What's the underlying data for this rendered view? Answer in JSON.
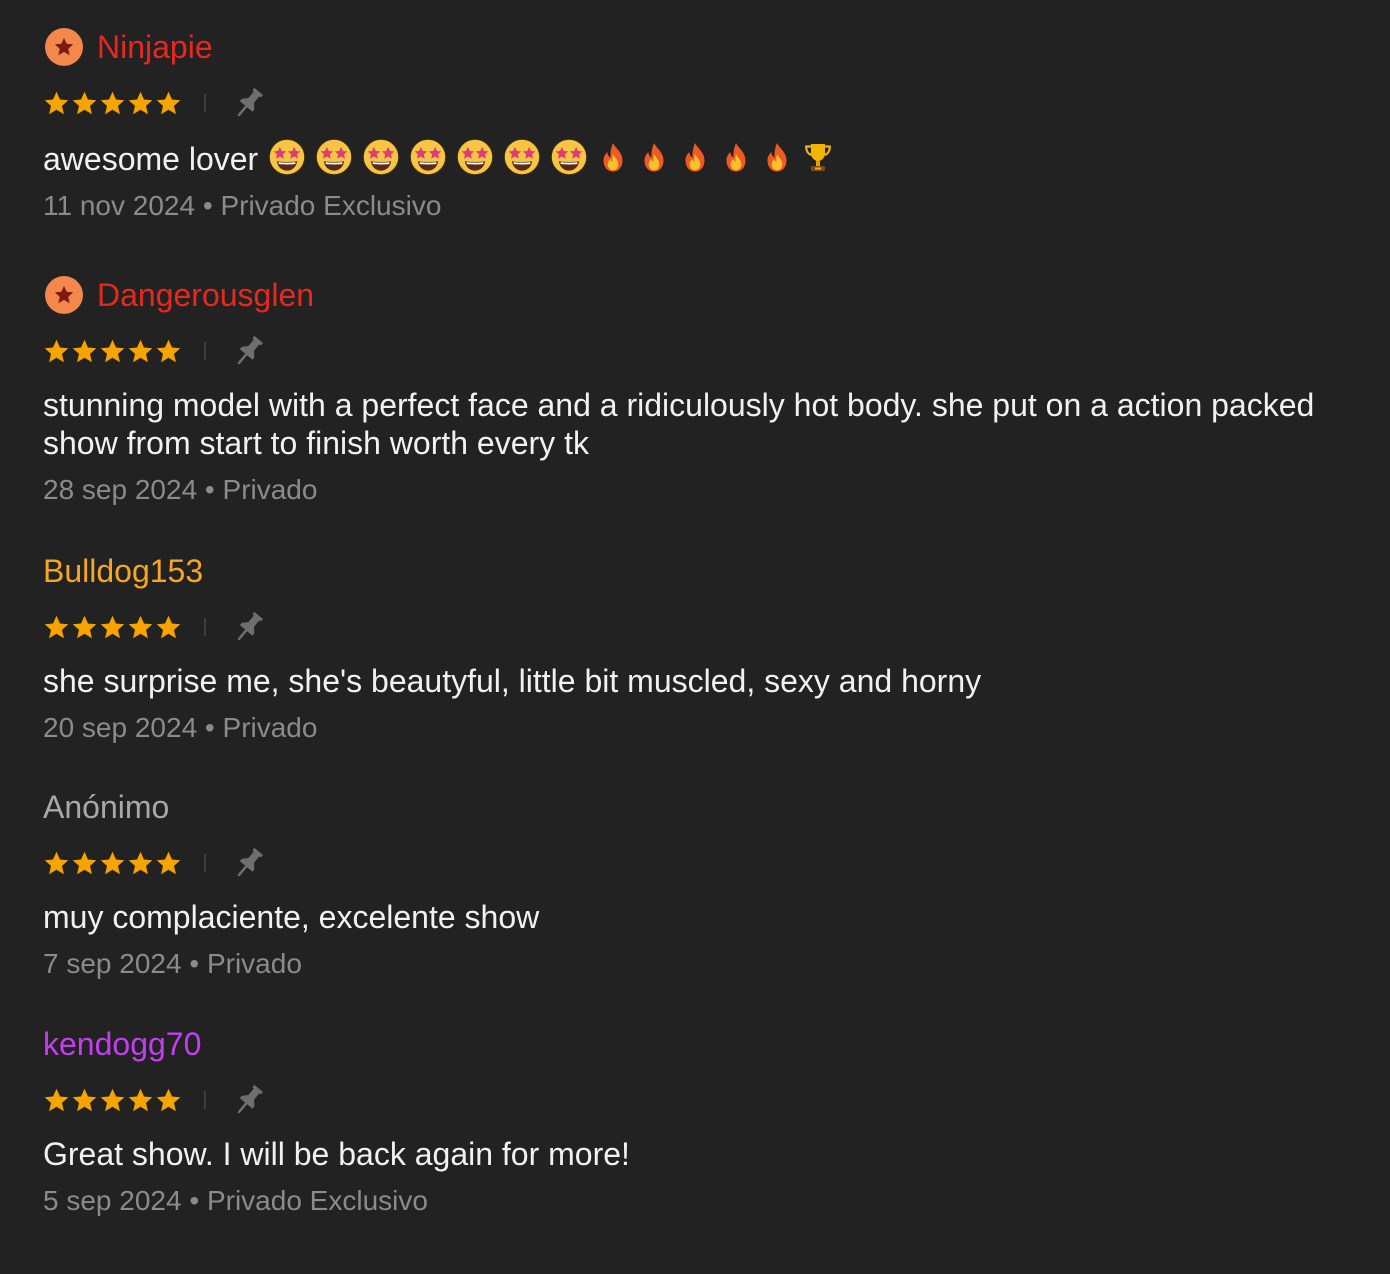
{
  "colors": {
    "background": "#222222",
    "star": "#f7a400",
    "badge": "#f4874b",
    "badge_star": "#7a1a12",
    "pin": "#6e6e6e",
    "meta_text": "#8b8b8b"
  },
  "reviews": [
    {
      "username": "Ninjapie",
      "username_color": "#e8281e",
      "badge": "star-badge-icon",
      "rating": 5,
      "text": "awesome lover",
      "emojis": [
        "star-struck",
        "star-struck",
        "star-struck",
        "star-struck",
        "star-struck",
        "star-struck",
        "star-struck",
        "fire",
        "fire",
        "fire",
        "fire",
        "fire",
        "trophy"
      ],
      "date": "11 nov 2024",
      "show_type": "Privado Exclusivo"
    },
    {
      "username": "Dangerousglen",
      "username_color": "#e8281e",
      "badge": "star-badge-icon",
      "rating": 5,
      "text": "stunning model with a perfect face and a ridiculously hot body. she put on a action packed show from start to finish worth every tk",
      "date": "28 sep 2024",
      "show_type": "Privado"
    },
    {
      "username": "Bulldog153",
      "username_color": "#f5a623",
      "rating": 5,
      "text": "she surprise me, she's beautyful, little bit muscled, sexy and horny",
      "date": "20 sep 2024",
      "show_type": "Privado"
    },
    {
      "username": "Anónimo",
      "username_color": "#a8a8a8",
      "rating": 5,
      "text": "muy complaciente, excelente show",
      "date": "7 sep 2024",
      "show_type": "Privado"
    },
    {
      "username": "kendogg70",
      "username_color": "#c43ef0",
      "rating": 5,
      "text": "Great show. I will be back again for more!",
      "date": "5 sep 2024",
      "show_type": "Privado Exclusivo"
    }
  ]
}
